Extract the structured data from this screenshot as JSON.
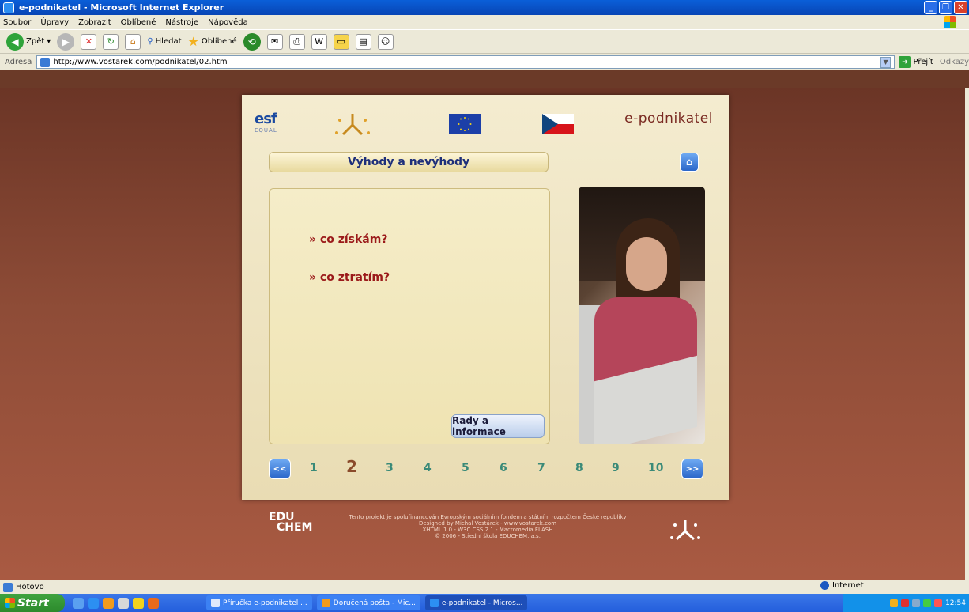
{
  "window": {
    "title": "e-podnikatel - Microsoft Internet Explorer"
  },
  "menubar": [
    "Soubor",
    "Úpravy",
    "Zobrazit",
    "Oblíbené",
    "Nástroje",
    "Nápověda"
  ],
  "toolbar": {
    "back_label": "Zpět",
    "search_label": "Hledat",
    "favorites_label": "Oblíbené"
  },
  "address": {
    "label": "Adresa",
    "url": "http://www.vostarek.com/podnikatel/02.htm",
    "go_label": "Přejít",
    "links_label": "Odkazy"
  },
  "page": {
    "brand": "e-podnikatel",
    "esf_logo": "esf",
    "esf_sub": "EQUAL",
    "section_title": "Výhody a nevýhody",
    "items": [
      "» co získám?",
      "» co ztratím?"
    ],
    "rady_button": "Rady a informace",
    "pager": {
      "prev": "<<",
      "next": ">>",
      "pages": [
        "1",
        "2",
        "3",
        "4",
        "5",
        "6",
        "7",
        "8",
        "9",
        "10"
      ],
      "current": "2"
    },
    "footer": {
      "logo_line1": "EDU",
      "logo_line2": "CHEM",
      "lines": [
        "Tento projekt je spolufinancován Evropským sociálním fondem a státním rozpočtem České republiky",
        "Designed by Michal Vostárek - www.vostarek.com",
        "XHTML 1.0 - W3C CSS 2.1 - Macromedia FLASH",
        "© 2006 - Střední škola EDUCHEM, a.s."
      ]
    }
  },
  "status": {
    "text": "Hotovo",
    "zone": "Internet"
  },
  "taskbar": {
    "start_label": "Start",
    "tasks": [
      "Příručka e-podnikatel ...",
      "Doručená pošta - Mic...",
      "e-podnikatel - Micros..."
    ],
    "clock": "12:54"
  },
  "colors": {
    "titlebar": "#0a5fd8",
    "brand": "#7a2a22",
    "section_title": "#1e2f7a",
    "item_text": "#9b1a1a",
    "pager_num": "#3a8a78",
    "pager_current": "#8a4a2a"
  }
}
